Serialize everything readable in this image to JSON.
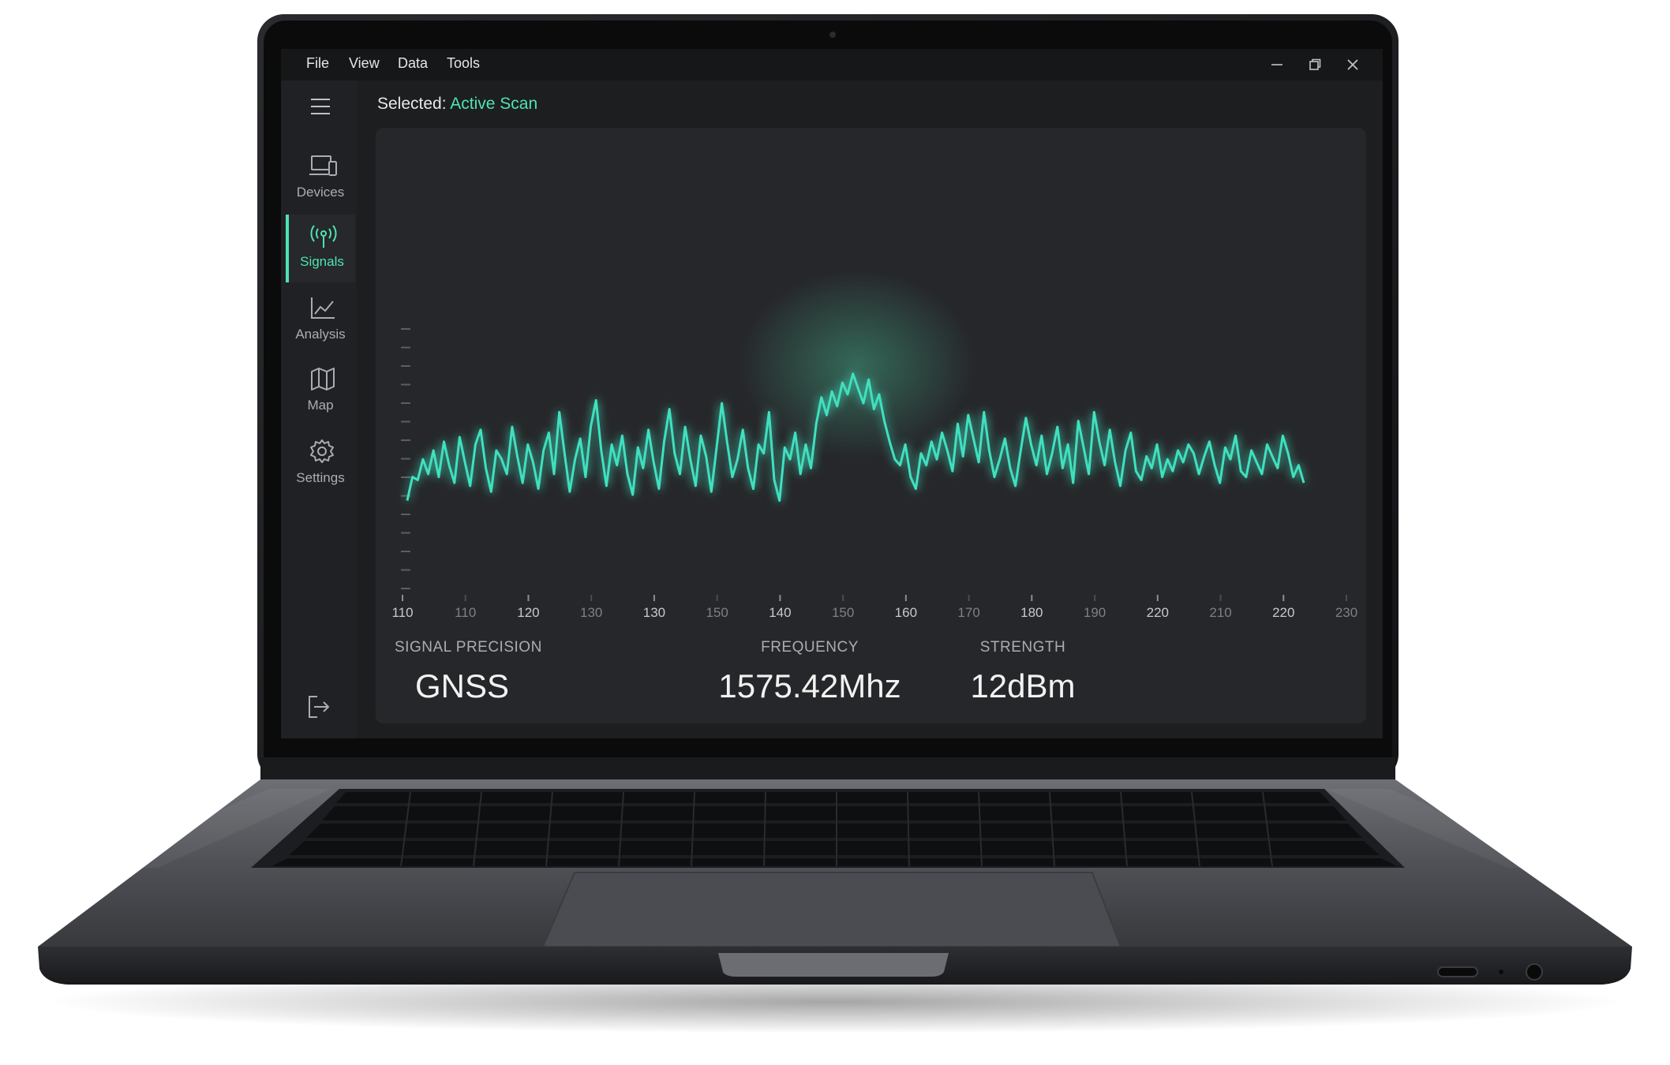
{
  "menu": [
    "File",
    "View",
    "Data",
    "Tools"
  ],
  "window_controls": [
    "minimize-icon",
    "restore-icon",
    "close-icon"
  ],
  "sidebar": {
    "items": [
      {
        "label": "Devices",
        "icon": "devices-icon"
      },
      {
        "label": "Signals",
        "icon": "antenna-icon",
        "active": true
      },
      {
        "label": "Analysis",
        "icon": "line-chart-icon"
      },
      {
        "label": "Map",
        "icon": "map-icon"
      },
      {
        "label": "Settings",
        "icon": "gear-icon"
      }
    ],
    "logout_icon": "logout-icon"
  },
  "selected": {
    "label": "Selected:",
    "value": "Active Scan"
  },
  "stats": [
    {
      "label": "SIGNAL PRECISION",
      "value": "GNSS"
    },
    {
      "label": "FREQUENCY",
      "value": "1575.42Mhz"
    },
    {
      "label": "STRENGTH",
      "value": "12dBm"
    }
  ],
  "colors": {
    "accent": "#4fe3b1",
    "signal": "#3fe0bf",
    "background": "#1d1e20"
  },
  "chart_data": {
    "type": "line",
    "x_tick_labels": [
      "110",
      "110",
      "120",
      "130",
      "130",
      "150",
      "140",
      "150",
      "160",
      "170",
      "180",
      "190",
      "220",
      "210",
      "220",
      "230"
    ],
    "series": [
      {
        "values": [
          0.12,
          0.28,
          0.26,
          0.4,
          0.3,
          0.46,
          0.28,
          0.52,
          0.36,
          0.24,
          0.55,
          0.38,
          0.22,
          0.5,
          0.6,
          0.34,
          0.18,
          0.46,
          0.4,
          0.3,
          0.62,
          0.42,
          0.24,
          0.5,
          0.38,
          0.2,
          0.46,
          0.58,
          0.3,
          0.72,
          0.44,
          0.18,
          0.4,
          0.54,
          0.28,
          0.62,
          0.8,
          0.46,
          0.22,
          0.5,
          0.36,
          0.56,
          0.3,
          0.16,
          0.48,
          0.34,
          0.6,
          0.38,
          0.2,
          0.52,
          0.74,
          0.44,
          0.3,
          0.62,
          0.4,
          0.22,
          0.56,
          0.42,
          0.18,
          0.48,
          0.78,
          0.52,
          0.28,
          0.4,
          0.6,
          0.34,
          0.2,
          0.5,
          0.44,
          0.72,
          0.26,
          0.12,
          0.48,
          0.4,
          0.58,
          0.3,
          0.5,
          0.34,
          0.64,
          0.82,
          0.7,
          0.86,
          0.76,
          0.92,
          0.84,
          0.98,
          0.88,
          0.78,
          0.94,
          0.74,
          0.84,
          0.66,
          0.52,
          0.4,
          0.36,
          0.5,
          0.28,
          0.2,
          0.44,
          0.36,
          0.52,
          0.4,
          0.58,
          0.46,
          0.32,
          0.64,
          0.42,
          0.7,
          0.54,
          0.38,
          0.72,
          0.46,
          0.28,
          0.4,
          0.54,
          0.34,
          0.22,
          0.46,
          0.68,
          0.5,
          0.36,
          0.56,
          0.3,
          0.44,
          0.62,
          0.34,
          0.5,
          0.24,
          0.66,
          0.48,
          0.3,
          0.72,
          0.52,
          0.36,
          0.6,
          0.38,
          0.22,
          0.46,
          0.58,
          0.32,
          0.26,
          0.42,
          0.34,
          0.5,
          0.28,
          0.4,
          0.32,
          0.46,
          0.38,
          0.5,
          0.44,
          0.3,
          0.42,
          0.52,
          0.36,
          0.24,
          0.48,
          0.4,
          0.56,
          0.32,
          0.28,
          0.46,
          0.38,
          0.3,
          0.5,
          0.42,
          0.34,
          0.56,
          0.44,
          0.28,
          0.36,
          0.24
        ]
      }
    ]
  }
}
